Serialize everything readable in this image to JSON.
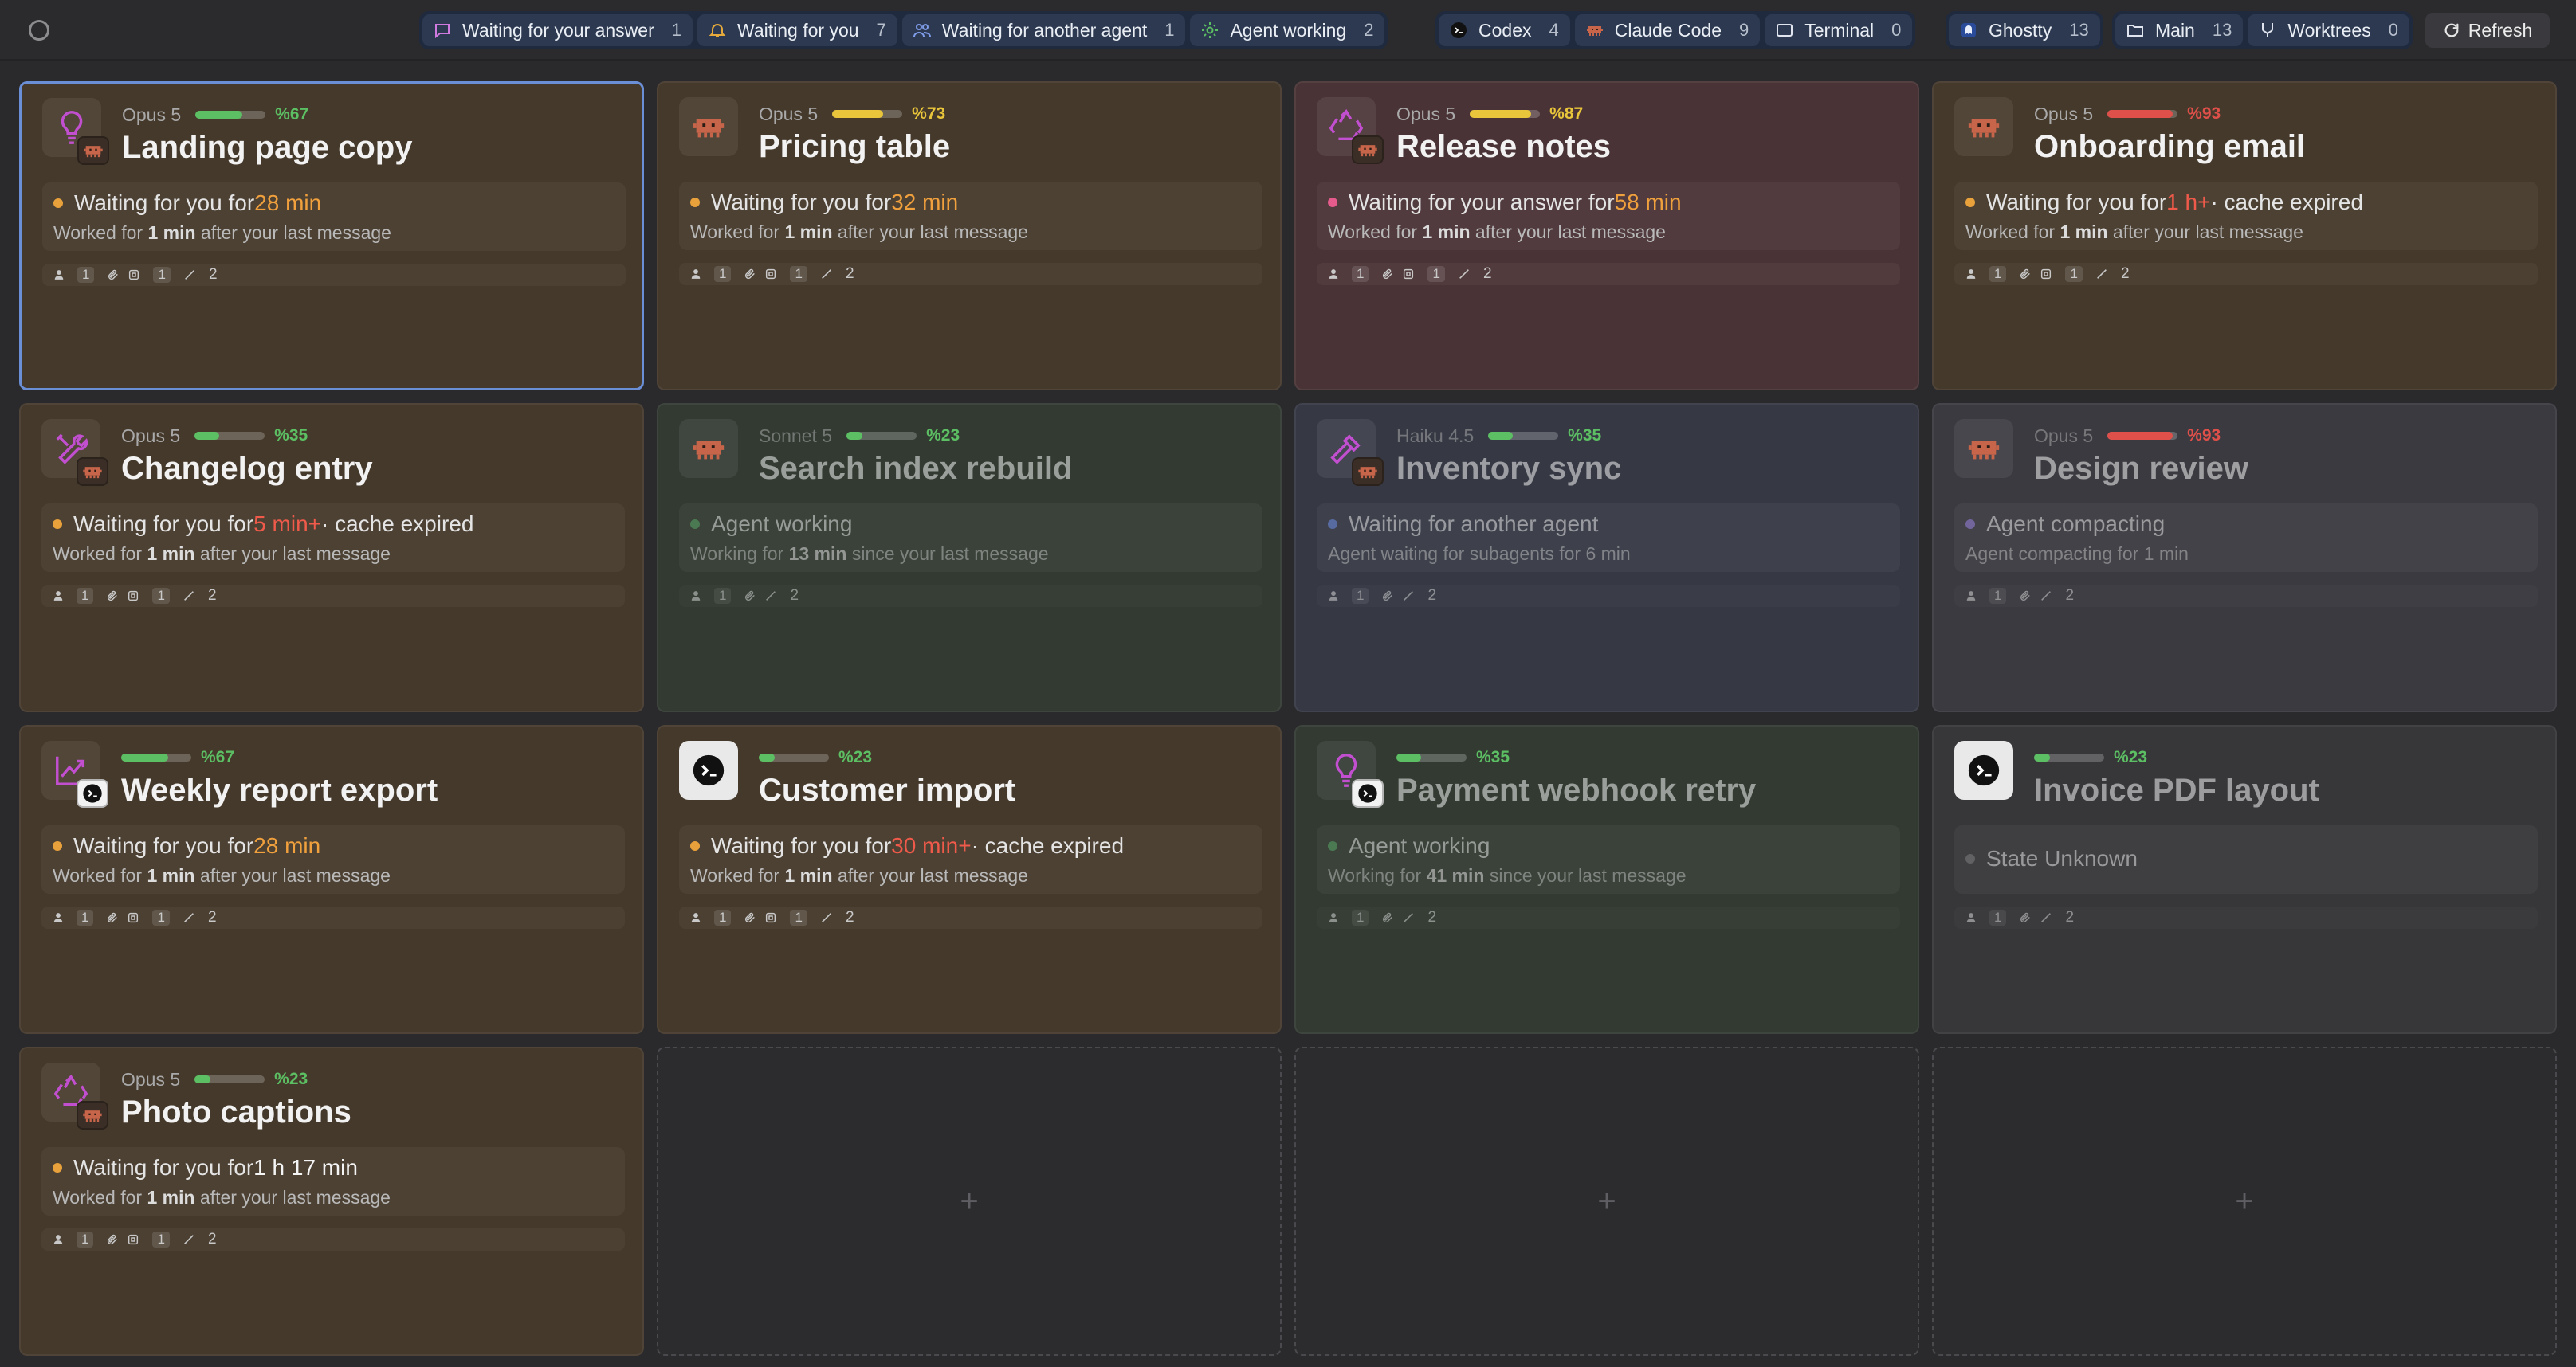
{
  "topbar": {
    "status_icon": "circle-icon",
    "groups": [
      {
        "chips": [
          {
            "icon": "chat-icon",
            "label": "Waiting for your answer",
            "count": "1",
            "color": "#c77ad6"
          },
          {
            "icon": "bell-icon",
            "label": "Waiting for you",
            "count": "7",
            "color": "#e3a33a"
          },
          {
            "icon": "people-icon",
            "label": "Waiting for another agent",
            "count": "1",
            "color": "#6f8fe6"
          },
          {
            "icon": "gear-icon",
            "label": "Agent working",
            "count": "2",
            "color": "#5cbf63"
          }
        ]
      },
      {
        "chips": [
          {
            "icon": "codex-icon",
            "label": "Codex",
            "count": "4"
          },
          {
            "icon": "claude-icon",
            "label": "Claude Code",
            "count": "9"
          },
          {
            "icon": "terminal-icon",
            "label": "Terminal",
            "count": "0"
          }
        ]
      },
      {
        "chips": [
          {
            "icon": "ghostty-icon",
            "label": "Ghostty",
            "count": "13"
          }
        ]
      },
      {
        "chips": [
          {
            "icon": "folder-icon",
            "label": "Main",
            "count": "13"
          },
          {
            "icon": "branch-icon",
            "label": "Worktrees",
            "count": "0"
          }
        ]
      }
    ],
    "refresh_label": "Refresh"
  },
  "colors": {
    "green": "#5cbf63",
    "yellow": "#e8c53a",
    "red": "#e0504a",
    "orange_dot": "#e9a23b",
    "pink_dot": "#e45b8c",
    "green_dot": "#5aa866",
    "blue_dot": "#6f8fe6",
    "purple_dot": "#9a82e0",
    "gray_dot": "#7d7d80"
  },
  "cards": [
    {
      "title": "Landing page copy",
      "model": "Opus 5",
      "meter": 0.67,
      "pct": "%67",
      "meter_color": "green",
      "avatar": "lightbulb-icon",
      "badge": "claude",
      "theme": "brown",
      "selected": true,
      "status": {
        "dot": "orange_dot",
        "pre": "Waiting for you for ",
        "hl": "28 min",
        "hl_class": "hl-orange",
        "post": ""
      },
      "detail": {
        "pre": "Worked for ",
        "b": "1 min",
        "post": " after your last message"
      },
      "badges": "full"
    },
    {
      "title": "Pricing table",
      "model": "Opus 5",
      "meter": 0.73,
      "pct": "%73",
      "meter_color": "yellow",
      "avatar": "claude-icon",
      "badge": "",
      "theme": "brown",
      "status": {
        "dot": "orange_dot",
        "pre": "Waiting for you for ",
        "hl": "32 min",
        "hl_class": "hl-orange",
        "post": ""
      },
      "detail": {
        "pre": "Worked for ",
        "b": "1 min",
        "post": " after your last message"
      },
      "badges": "full"
    },
    {
      "title": "Release notes",
      "model": "Opus 5",
      "meter": 0.87,
      "pct": "%87",
      "meter_color": "yellow",
      "avatar": "recycle-icon",
      "badge": "claude",
      "theme": "red",
      "status": {
        "dot": "pink_dot",
        "pre": "Waiting for your answer for ",
        "hl": "58 min",
        "hl_class": "hl-orange",
        "post": ""
      },
      "detail": {
        "pre": "Worked for ",
        "b": "1 min",
        "post": " after your last message"
      },
      "badges": "full"
    },
    {
      "title": "Onboarding email",
      "model": "Opus 5",
      "meter": 0.93,
      "pct": "%93",
      "meter_color": "red",
      "avatar": "claude-icon",
      "badge": "",
      "theme": "brown",
      "status": {
        "dot": "orange_dot",
        "pre": "Waiting for you for ",
        "hl": "1 h+",
        "hl_class": "hl-red",
        "post": " · cache expired"
      },
      "detail": {
        "pre": "Worked for ",
        "b": "1 min",
        "post": " after your last message"
      },
      "badges": "full"
    },
    {
      "title": "Changelog entry",
      "model": "Opus 5",
      "meter": 0.35,
      "pct": "%35",
      "meter_color": "green",
      "avatar": "tools-icon",
      "badge": "claude",
      "theme": "brown",
      "status": {
        "dot": "orange_dot",
        "pre": "Waiting for you for ",
        "hl": "5 min+",
        "hl_class": "hl-red",
        "post": " · cache expired"
      },
      "detail": {
        "pre": "Worked for ",
        "b": "1 min",
        "post": " after your last message"
      },
      "badges": "full"
    },
    {
      "title": "Search index rebuild",
      "model": "Sonnet 5",
      "meter": 0.23,
      "pct": "%23",
      "meter_color": "green",
      "avatar": "claude-icon",
      "badge": "",
      "theme": "green",
      "dim": true,
      "status": {
        "dot": "green_dot",
        "pre": "Agent working",
        "hl": "",
        "hl_class": "",
        "post": ""
      },
      "detail": {
        "pre": "Working for ",
        "b": "13 min",
        "post": " since your last message"
      },
      "badges": "short"
    },
    {
      "title": "Inventory sync",
      "model": "Haiku 4.5",
      "meter": 0.35,
      "pct": "%35",
      "meter_color": "green",
      "avatar": "hammer-icon",
      "badge": "claude",
      "theme": "blue",
      "dim": true,
      "status": {
        "dot": "blue_dot",
        "pre": "Waiting for another agent",
        "hl": "",
        "hl_class": "",
        "post": ""
      },
      "detail": {
        "pre": "Agent waiting for subagents for 6 min",
        "b": "",
        "post": ""
      },
      "badges": "short"
    },
    {
      "title": "Design review",
      "model": "Opus 5",
      "meter": 0.93,
      "pct": "%93",
      "meter_color": "red",
      "avatar": "claude-icon",
      "badge": "",
      "theme": "slate",
      "dim": true,
      "status": {
        "dot": "purple_dot",
        "pre": "Agent compacting",
        "hl": "",
        "hl_class": "",
        "post": ""
      },
      "detail": {
        "pre": "Agent compacting for 1 min",
        "b": "",
        "post": ""
      },
      "badges": "short"
    },
    {
      "title": "Weekly report export",
      "model": "",
      "meter": 0.67,
      "pct": "%67",
      "meter_color": "green",
      "avatar": "chart-up-icon",
      "badge": "codex",
      "theme": "brown",
      "status": {
        "dot": "orange_dot",
        "pre": "Waiting for you for ",
        "hl": "28 min",
        "hl_class": "hl-orange",
        "post": ""
      },
      "detail": {
        "pre": "Worked for ",
        "b": "1 min",
        "post": " after your last message"
      },
      "badges": "full"
    },
    {
      "title": "Customer import",
      "model": "",
      "meter": 0.23,
      "pct": "%23",
      "meter_color": "green",
      "avatar": "codex-icon",
      "badge": "",
      "theme": "brown",
      "avatar_white": true,
      "status": {
        "dot": "orange_dot",
        "pre": "Waiting for you for ",
        "hl": "30 min+",
        "hl_class": "hl-red",
        "post": " · cache expired"
      },
      "detail": {
        "pre": "Worked for ",
        "b": "1 min",
        "post": " after your last message"
      },
      "badges": "full"
    },
    {
      "title": "Payment webhook retry",
      "model": "",
      "meter": 0.35,
      "pct": "%35",
      "meter_color": "green",
      "avatar": "lightbulb-icon",
      "badge": "codex",
      "theme": "green",
      "dim": true,
      "status": {
        "dot": "green_dot",
        "pre": "Agent working",
        "hl": "",
        "hl_class": "",
        "post": ""
      },
      "detail": {
        "pre": "Working for ",
        "b": "41 min",
        "post": " since your last message"
      },
      "badges": "short"
    },
    {
      "title": "Invoice PDF layout",
      "model": "",
      "meter": 0.23,
      "pct": "%23",
      "meter_color": "green",
      "avatar": "codex-icon",
      "badge": "",
      "theme": "gray",
      "dim": true,
      "avatar_white": true,
      "status": {
        "dot": "gray_dot",
        "pre": "State Unknown",
        "hl": "",
        "hl_class": "",
        "post": "",
        "center": true
      },
      "detail": null,
      "badges": "short"
    },
    {
      "title": "Photo captions",
      "model": "Opus 5",
      "meter": 0.23,
      "pct": "%23",
      "meter_color": "green",
      "avatar": "recycle-icon",
      "badge": "claude",
      "theme": "brown",
      "status": {
        "dot": "orange_dot",
        "pre": "Waiting for you for ",
        "hl": "1 h 17 min",
        "hl_class": "hl-white",
        "post": ""
      },
      "detail": {
        "pre": "Worked for ",
        "b": "1 min",
        "post": " after your last message"
      },
      "badges": "full"
    }
  ],
  "badge_values": {
    "person": "1",
    "clip": "",
    "box": "1",
    "edits": "2"
  },
  "empty_slot_glyph": "+"
}
